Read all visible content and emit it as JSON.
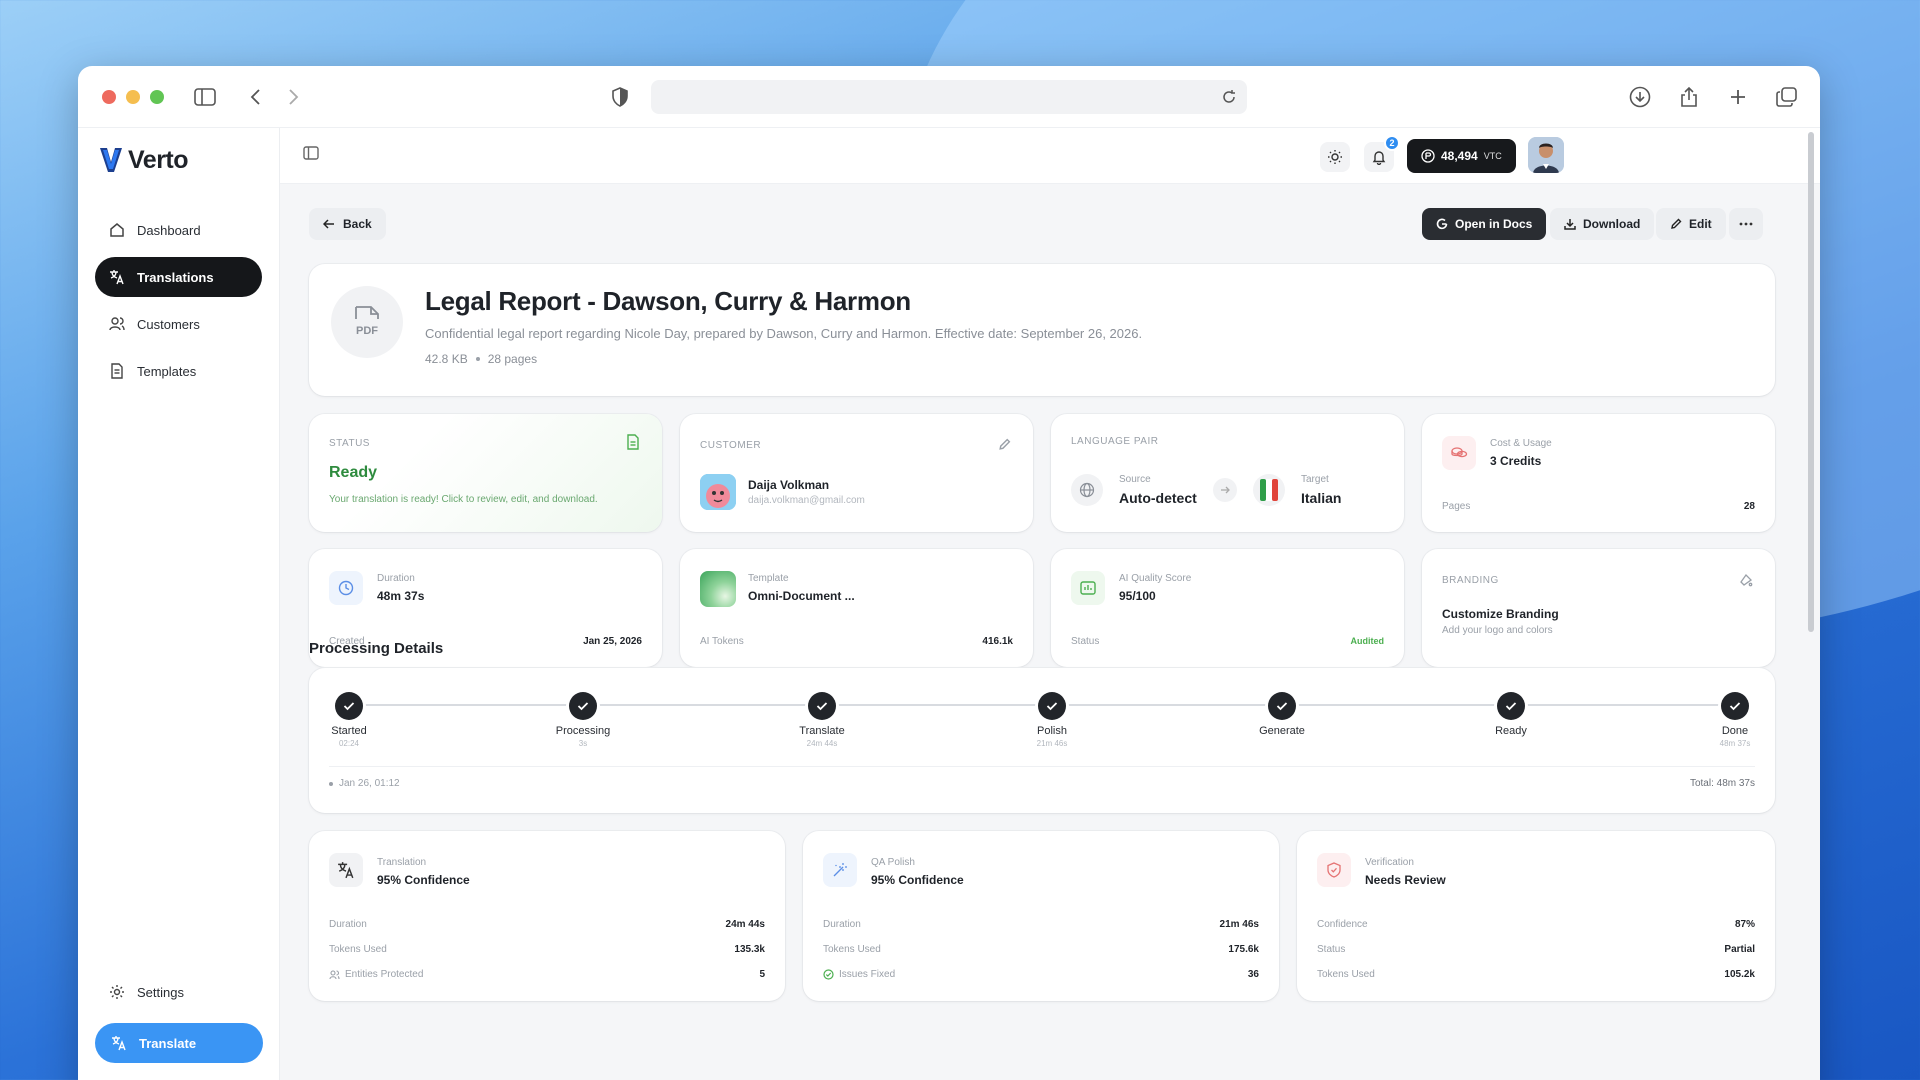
{
  "app": {
    "name": "Verto"
  },
  "sidebar": {
    "items": [
      {
        "label": "Dashboard"
      },
      {
        "label": "Translations"
      },
      {
        "label": "Customers"
      },
      {
        "label": "Templates"
      }
    ],
    "settings_label": "Settings",
    "translate_label": "Translate"
  },
  "topbar": {
    "notification_count": "2",
    "credits": "48,494",
    "credits_unit": "VTC"
  },
  "actions": {
    "back": "Back",
    "open_docs": "Open in Docs",
    "download": "Download",
    "edit": "Edit"
  },
  "document": {
    "icon_label": "PDF",
    "title": "Legal Report - Dawson, Curry & Harmon",
    "description": "Confidential legal report regarding Nicole Day, prepared by Dawson, Curry and Harmon. Effective date: September 26, 2026.",
    "size": "42.8 KB",
    "pages": "28 pages"
  },
  "cards": {
    "status": {
      "label": "STATUS",
      "value": "Ready",
      "message": "Your translation is ready! Click to review, edit, and download."
    },
    "customer": {
      "label": "CUSTOMER",
      "name": "Daija Volkman",
      "email": "daija.volkman@gmail.com"
    },
    "language": {
      "label": "LANGUAGE PAIR",
      "source_label": "Source",
      "source": "Auto-detect",
      "target_label": "Target",
      "target": "Italian"
    },
    "cost": {
      "label": "Cost & Usage",
      "value": "3 Credits",
      "pages_label": "Pages",
      "pages": "28"
    },
    "duration": {
      "label": "Duration",
      "value": "48m 37s",
      "created_label": "Created",
      "created": "Jan 25, 2026"
    },
    "template": {
      "label": "Template",
      "value": "Omni-Document ...",
      "tokens_label": "AI Tokens",
      "tokens": "416.1k"
    },
    "quality": {
      "label": "AI Quality Score",
      "value": "95/100",
      "status_label": "Status",
      "status": "Audited"
    },
    "branding": {
      "label": "BRANDING",
      "title": "Customize Branding",
      "subtitle": "Add your logo and colors"
    }
  },
  "processing": {
    "title": "Processing Details",
    "steps": [
      {
        "name": "Started",
        "time": "02:24"
      },
      {
        "name": "Processing",
        "time": "3s"
      },
      {
        "name": "Translate",
        "time": "24m 44s"
      },
      {
        "name": "Polish",
        "time": "21m 46s"
      },
      {
        "name": "Generate",
        "time": ""
      },
      {
        "name": "Ready",
        "time": ""
      },
      {
        "name": "Done",
        "time": "48m 37s"
      }
    ],
    "footer_date": "Jan 26, 01:12",
    "total": "Total: 48m 37s"
  },
  "details": {
    "translation": {
      "label": "Translation",
      "value": "95% Confidence",
      "rows": [
        {
          "k": "Duration",
          "v": "24m 44s"
        },
        {
          "k": "Tokens Used",
          "v": "135.3k"
        },
        {
          "k": "Entities Protected",
          "v": "5"
        }
      ]
    },
    "qa": {
      "label": "QA Polish",
      "value": "95% Confidence",
      "rows": [
        {
          "k": "Duration",
          "v": "21m 46s"
        },
        {
          "k": "Tokens Used",
          "v": "175.6k"
        },
        {
          "k": "Issues Fixed",
          "v": "36"
        }
      ]
    },
    "verification": {
      "label": "Verification",
      "value": "Needs Review",
      "rows": [
        {
          "k": "Confidence",
          "v": "87%"
        },
        {
          "k": "Status",
          "v": "Partial"
        },
        {
          "k": "Tokens Used",
          "v": "105.2k"
        }
      ]
    }
  },
  "colors": {
    "accent": "#3a95f4",
    "ready": "#2e8b3e",
    "dark": "#15171a"
  }
}
